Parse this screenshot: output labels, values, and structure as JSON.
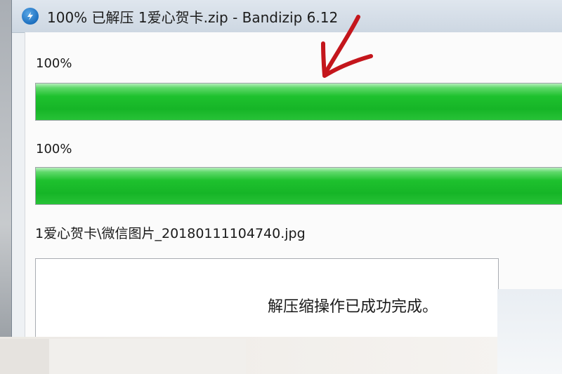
{
  "window": {
    "title": "100% 已解压 1爱心贺卡.zip - Bandizip 6.12",
    "app_icon": "bandizip-icon"
  },
  "progress": {
    "overall": {
      "label": "100%",
      "value": 1.0
    },
    "file": {
      "label": "100%",
      "value": 1.0
    }
  },
  "current_file": "1爱心贺卡\\微信图片_20180111104740.jpg",
  "message": "解压缩操作已成功完成。",
  "colors": {
    "progress_fill": "#1ec12e",
    "annotation": "#c4161c"
  }
}
